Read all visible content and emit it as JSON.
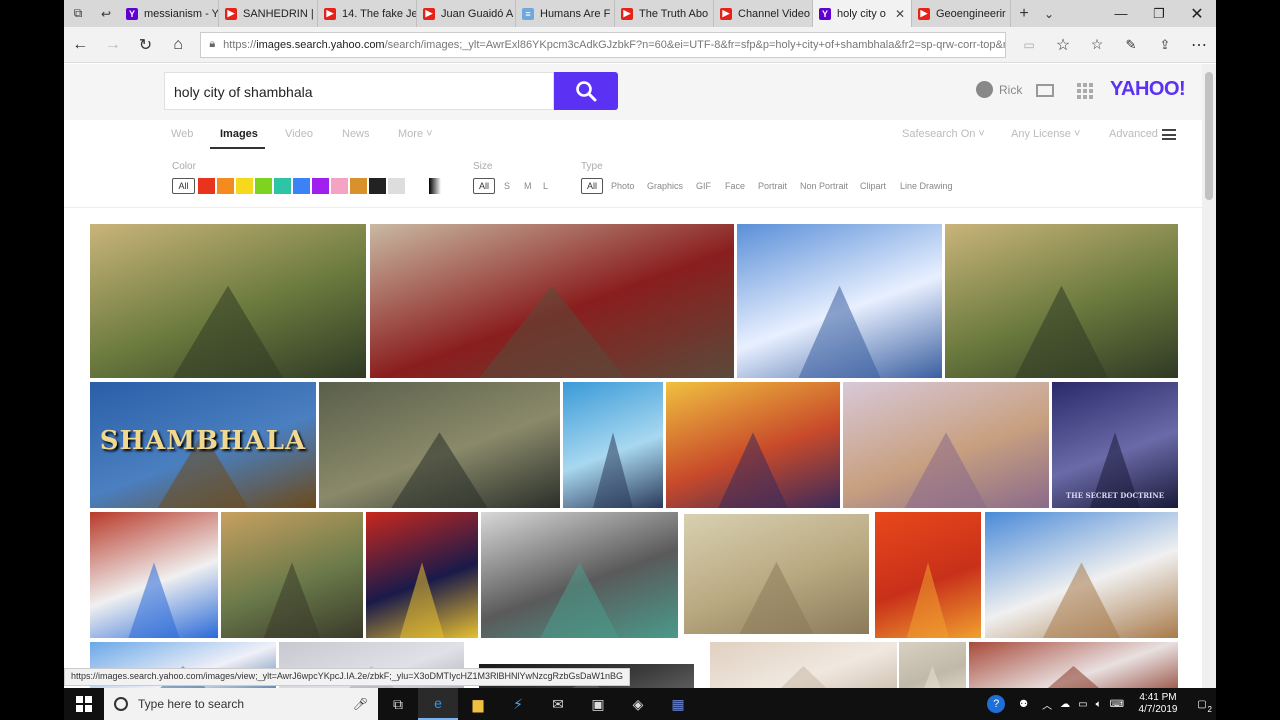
{
  "tabs": [
    {
      "label": "messianism - Y",
      "favicon": "yahoo",
      "active": false
    },
    {
      "label": "SANHEDRIN |",
      "favicon": "youtube",
      "active": false
    },
    {
      "label": "14. The fake Je",
      "favicon": "youtube",
      "active": false
    },
    {
      "label": "Juan Guaidó A",
      "favicon": "youtube",
      "active": false
    },
    {
      "label": "Humans Are F",
      "favicon": "document",
      "active": false
    },
    {
      "label": "The Truth Abo",
      "favicon": "youtube",
      "active": false
    },
    {
      "label": "Channel Video",
      "favicon": "youtube",
      "active": false
    },
    {
      "label": "holy city o",
      "favicon": "yahoo",
      "active": true
    },
    {
      "label": "Geoengineerir",
      "favicon": "youtube",
      "active": false
    }
  ],
  "address": {
    "prefix": "https://",
    "host": "images.search.yahoo.com",
    "path": "/search/images;_ylt=AwrExl86YKpcm3cAdkGJzbkF?n=60&ei=UTF-8&fr=sfp&p=holy+city+of+shambhala&fr2=sp-qrw-corr-top&no"
  },
  "search": {
    "query": "holy city of shambhala"
  },
  "header": {
    "user_name": "Rick",
    "logo": "YAHOO!"
  },
  "vertical_nav": {
    "items": [
      "Web",
      "Images",
      "Video",
      "News",
      "More ˅"
    ],
    "active": "Images",
    "safesearch": "Safesearch On ˅",
    "license": "Any License ˅",
    "advanced": "Advanced"
  },
  "filters": {
    "color_label": "Color",
    "color_all": "All",
    "colors": [
      "#e8341c",
      "#f58b1f",
      "#f7d91b",
      "#7ed321",
      "#2ec4a6",
      "#3b82f6",
      "#a020f0",
      "#f4a3c4",
      "#d9912b",
      "#222222",
      "#dddddd"
    ],
    "size_label": "Size",
    "size_options": [
      "All",
      "S",
      "M",
      "L"
    ],
    "type_label": "Type",
    "type_options": [
      "All",
      "Photo",
      "Graphics",
      "GIF",
      "Face",
      "Portrait",
      "Non Portrait",
      "Clipart",
      "Line Drawing"
    ]
  },
  "thumbnails": [
    {
      "caption": "",
      "palette": [
        "#c9b47a",
        "#6b7a3e",
        "#2f3a24"
      ]
    },
    {
      "caption": "",
      "palette": [
        "#c9b9a3",
        "#8a1e1e",
        "#5a4a3a"
      ]
    },
    {
      "caption": "",
      "palette": [
        "#5a8fd8",
        "#e8f0ff",
        "#3a5fa0"
      ]
    },
    {
      "caption": "",
      "palette": [
        "#c9b47a",
        "#6b7a3e",
        "#2f3a24"
      ]
    },
    {
      "caption": "SHAMBHALA",
      "palette": [
        "#2a5fa8",
        "#4a7fc0",
        "#6b4a1a"
      ]
    },
    {
      "caption": "",
      "palette": [
        "#5a5f4a",
        "#8a8a6a",
        "#2a2f2a"
      ]
    },
    {
      "caption": "",
      "palette": [
        "#3a9ad8",
        "#a8d8f0",
        "#2a3a5a"
      ]
    },
    {
      "caption": "",
      "palette": [
        "#f0c040",
        "#c84a2a",
        "#3a2a5a"
      ]
    },
    {
      "caption": "",
      "palette": [
        "#d8c8d8",
        "#c8a080",
        "#8a6a8a"
      ]
    },
    {
      "caption": "THE SECRET DOCTRINE",
      "palette": [
        "#2a2a6a",
        "#6a6aa8",
        "#1a1a3a"
      ]
    },
    {
      "caption": "",
      "palette": [
        "#b83a2a",
        "#f0f0f0",
        "#2a6ad8"
      ]
    },
    {
      "caption": "",
      "palette": [
        "#c8a060",
        "#6a7a4a",
        "#3a3a2a"
      ]
    },
    {
      "caption": "",
      "palette": [
        "#c8281e",
        "#1a1a4a",
        "#e8c030"
      ]
    },
    {
      "caption": "",
      "palette": [
        "#d8d8d8",
        "#5a5a5a",
        "#4a9a8a"
      ]
    },
    {
      "caption": "",
      "palette": [
        "#d8d0b0",
        "#b8a880",
        "#8a7a5a"
      ]
    },
    {
      "caption": "",
      "palette": [
        "#e8481a",
        "#c8301a",
        "#f0a030"
      ]
    },
    {
      "caption": "",
      "palette": [
        "#4a8ad8",
        "#f0f0f0",
        "#a87a4a"
      ]
    },
    {
      "caption": "",
      "palette": [
        "#6aa8e8",
        "#f0f0f8",
        "#3a6a9a"
      ]
    },
    {
      "caption": "",
      "palette": [
        "#c8c8d0",
        "#e0e0e8",
        "#a8a8b0"
      ]
    },
    {
      "caption": "",
      "palette": [
        "#1a1a1a",
        "#3a3a3a",
        "#6a6a6a"
      ]
    },
    {
      "caption": "",
      "palette": [
        "#e0d0c0",
        "#f0e8e0",
        "#c8b8a8"
      ]
    },
    {
      "caption": "",
      "palette": [
        "#d8d0c0",
        "#c0b8a8",
        "#e8e0d0"
      ]
    },
    {
      "caption": "",
      "palette": [
        "#a84a3a",
        "#e8e0e0",
        "#8a3a2a"
      ]
    }
  ],
  "status_url": "https://images.search.yahoo.com/images/view;_ylt=AwrJ6wpcYKpcJ.IA.2e/zbkF;_ylu=X3oDMTIycHZ1M3RlBHNlYwNzcgRzbGsDaW1nBG",
  "taskbar": {
    "search_placeholder": "Type here to search",
    "time": "4:41 PM",
    "date": "4/7/2019",
    "notification_count": "2"
  }
}
